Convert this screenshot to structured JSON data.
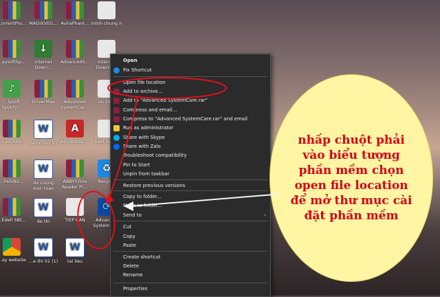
{
  "desktop_icons": [
    {
      "label": "…orrentPro…",
      "kind": "winrar"
    },
    {
      "label": "MAGIXVEG…",
      "kind": "winrar"
    },
    {
      "label": "AviraPhant…",
      "kind": "winrar"
    },
    {
      "label": "minh chung n",
      "kind": "exe"
    },
    {
      "label": "…aysoftSp…",
      "kind": "winrar"
    },
    {
      "label": "Internet Down…",
      "kind": "idm"
    },
    {
      "label": "AdvancedS…",
      "kind": "winrar"
    },
    {
      "label": "Internet Downlo…",
      "kind": "exe"
    },
    {
      "label": "…lysoft Spotify…",
      "kind": "green"
    },
    {
      "label": "DriverMax",
      "kind": "winrar"
    },
    {
      "label": "Advanced SystemCar…",
      "kind": "winrar"
    },
    {
      "label": "…on DAA…",
      "kind": "exe"
    },
    {
      "label": "…SunDubli…",
      "kind": "winrar"
    },
    {
      "label": "de on lop 10",
      "kind": "word"
    },
    {
      "label": "AcroRdrDC…",
      "kind": "pdf"
    },
    {
      "label": "Best Sch…",
      "kind": "exe"
    },
    {
      "label": "…PeSilks…",
      "kind": "winrar"
    },
    {
      "label": "de cuong mon toan",
      "kind": "word"
    },
    {
      "label": "ABBYY.Fine Reader Pr…",
      "kind": "winrar"
    },
    {
      "label": "Recycle",
      "kind": "blue"
    },
    {
      "label": "…Edell SBt…",
      "kind": "winrar"
    },
    {
      "label": "de thi",
      "kind": "word"
    },
    {
      "label": "TIEP CAN",
      "kind": "exe"
    },
    {
      "label": "Advanced SystemCa…",
      "kind": "asc"
    },
    {
      "label": "…ay website",
      "kind": "chrome"
    },
    {
      "label": "…e thi 01 (1)",
      "kind": "word"
    },
    {
      "label": "tai lieu",
      "kind": "word"
    }
  ],
  "menu": {
    "items": [
      {
        "label": "Open",
        "icon": "",
        "arrow": false
      },
      {
        "label": "Fix Shortcut",
        "icon": "blue-circle-icon",
        "arrow": false
      },
      {
        "label": "Open file location",
        "icon": "",
        "arrow": false
      },
      {
        "label": "Add to archive...",
        "icon": "winrar-icon",
        "arrow": false
      },
      {
        "label": "Add to \"Advanced SystemCare.rar\"",
        "icon": "winrar-icon",
        "arrow": false
      },
      {
        "label": "Compress and email...",
        "icon": "winrar-icon",
        "arrow": false
      },
      {
        "label": "Compress to \"Advanced SystemCare.rar\" and email",
        "icon": "winrar-icon",
        "arrow": false
      },
      {
        "label": "Run as administrator",
        "icon": "shield-icon",
        "arrow": false
      },
      {
        "label": "Share with Skype",
        "icon": "skype-icon",
        "arrow": false
      },
      {
        "label": "Share with Zalo",
        "icon": "zalo-icon",
        "arrow": false
      },
      {
        "label": "Troubleshoot compatibility",
        "icon": "",
        "arrow": false
      },
      {
        "label": "Pin to Start",
        "icon": "",
        "arrow": false
      },
      {
        "label": "Unpin from taskbar",
        "icon": "",
        "arrow": false
      },
      {
        "label": "Restore previous versions",
        "icon": "",
        "arrow": false
      },
      {
        "label": "Copy to folder...",
        "icon": "",
        "arrow": false
      },
      {
        "label": "Move to folder...",
        "icon": "",
        "arrow": false
      },
      {
        "label": "Send to",
        "icon": "",
        "arrow": true
      },
      {
        "label": "Cut",
        "icon": "",
        "arrow": false
      },
      {
        "label": "Copy",
        "icon": "",
        "arrow": false
      },
      {
        "label": "Paste",
        "icon": "",
        "arrow": false
      },
      {
        "label": "Create shortcut",
        "icon": "",
        "arrow": false
      },
      {
        "label": "Delete",
        "icon": "",
        "arrow": false
      },
      {
        "label": "Rename",
        "icon": "",
        "arrow": false
      },
      {
        "label": "Properties",
        "icon": "",
        "arrow": false
      }
    ]
  },
  "callout": {
    "text": "nhấp chuột phải vào biểu tượng phần mềm chọn open file location để mở thư mục cài đặt phần mềm"
  },
  "colors": {
    "annotation": "#e0101a",
    "callout_fill": "#fff5a3"
  }
}
